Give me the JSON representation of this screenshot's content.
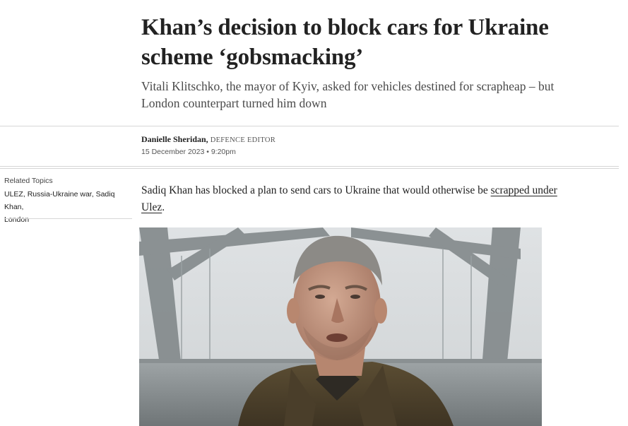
{
  "article": {
    "headline": "Khan’s decision to block cars for Ukraine scheme ‘gobsmacking’",
    "standfirst": "Vitali Klitschko, the mayor of Kyiv, asked for vehicles destined for scrapheap – but London counterpart turned him down",
    "author": "Danielle Sheridan,",
    "author_role": "DEFENCE EDITOR",
    "date": "15 December 2023 • 9:20pm",
    "body_before_link": "Sadiq Khan has blocked a plan to send cars to Ukraine that would otherwise be ",
    "body_link": "scrapped under Ulez",
    "body_after_link": "."
  },
  "related": {
    "label": "Related Topics",
    "topics": [
      "ULEZ",
      "Russia-Ukraine war",
      "Sadiq Khan",
      "London"
    ],
    "separator": ", "
  },
  "colors": {
    "rule": "#d6d6d6",
    "text": "#222222",
    "standfirst": "#4a4a4a"
  }
}
